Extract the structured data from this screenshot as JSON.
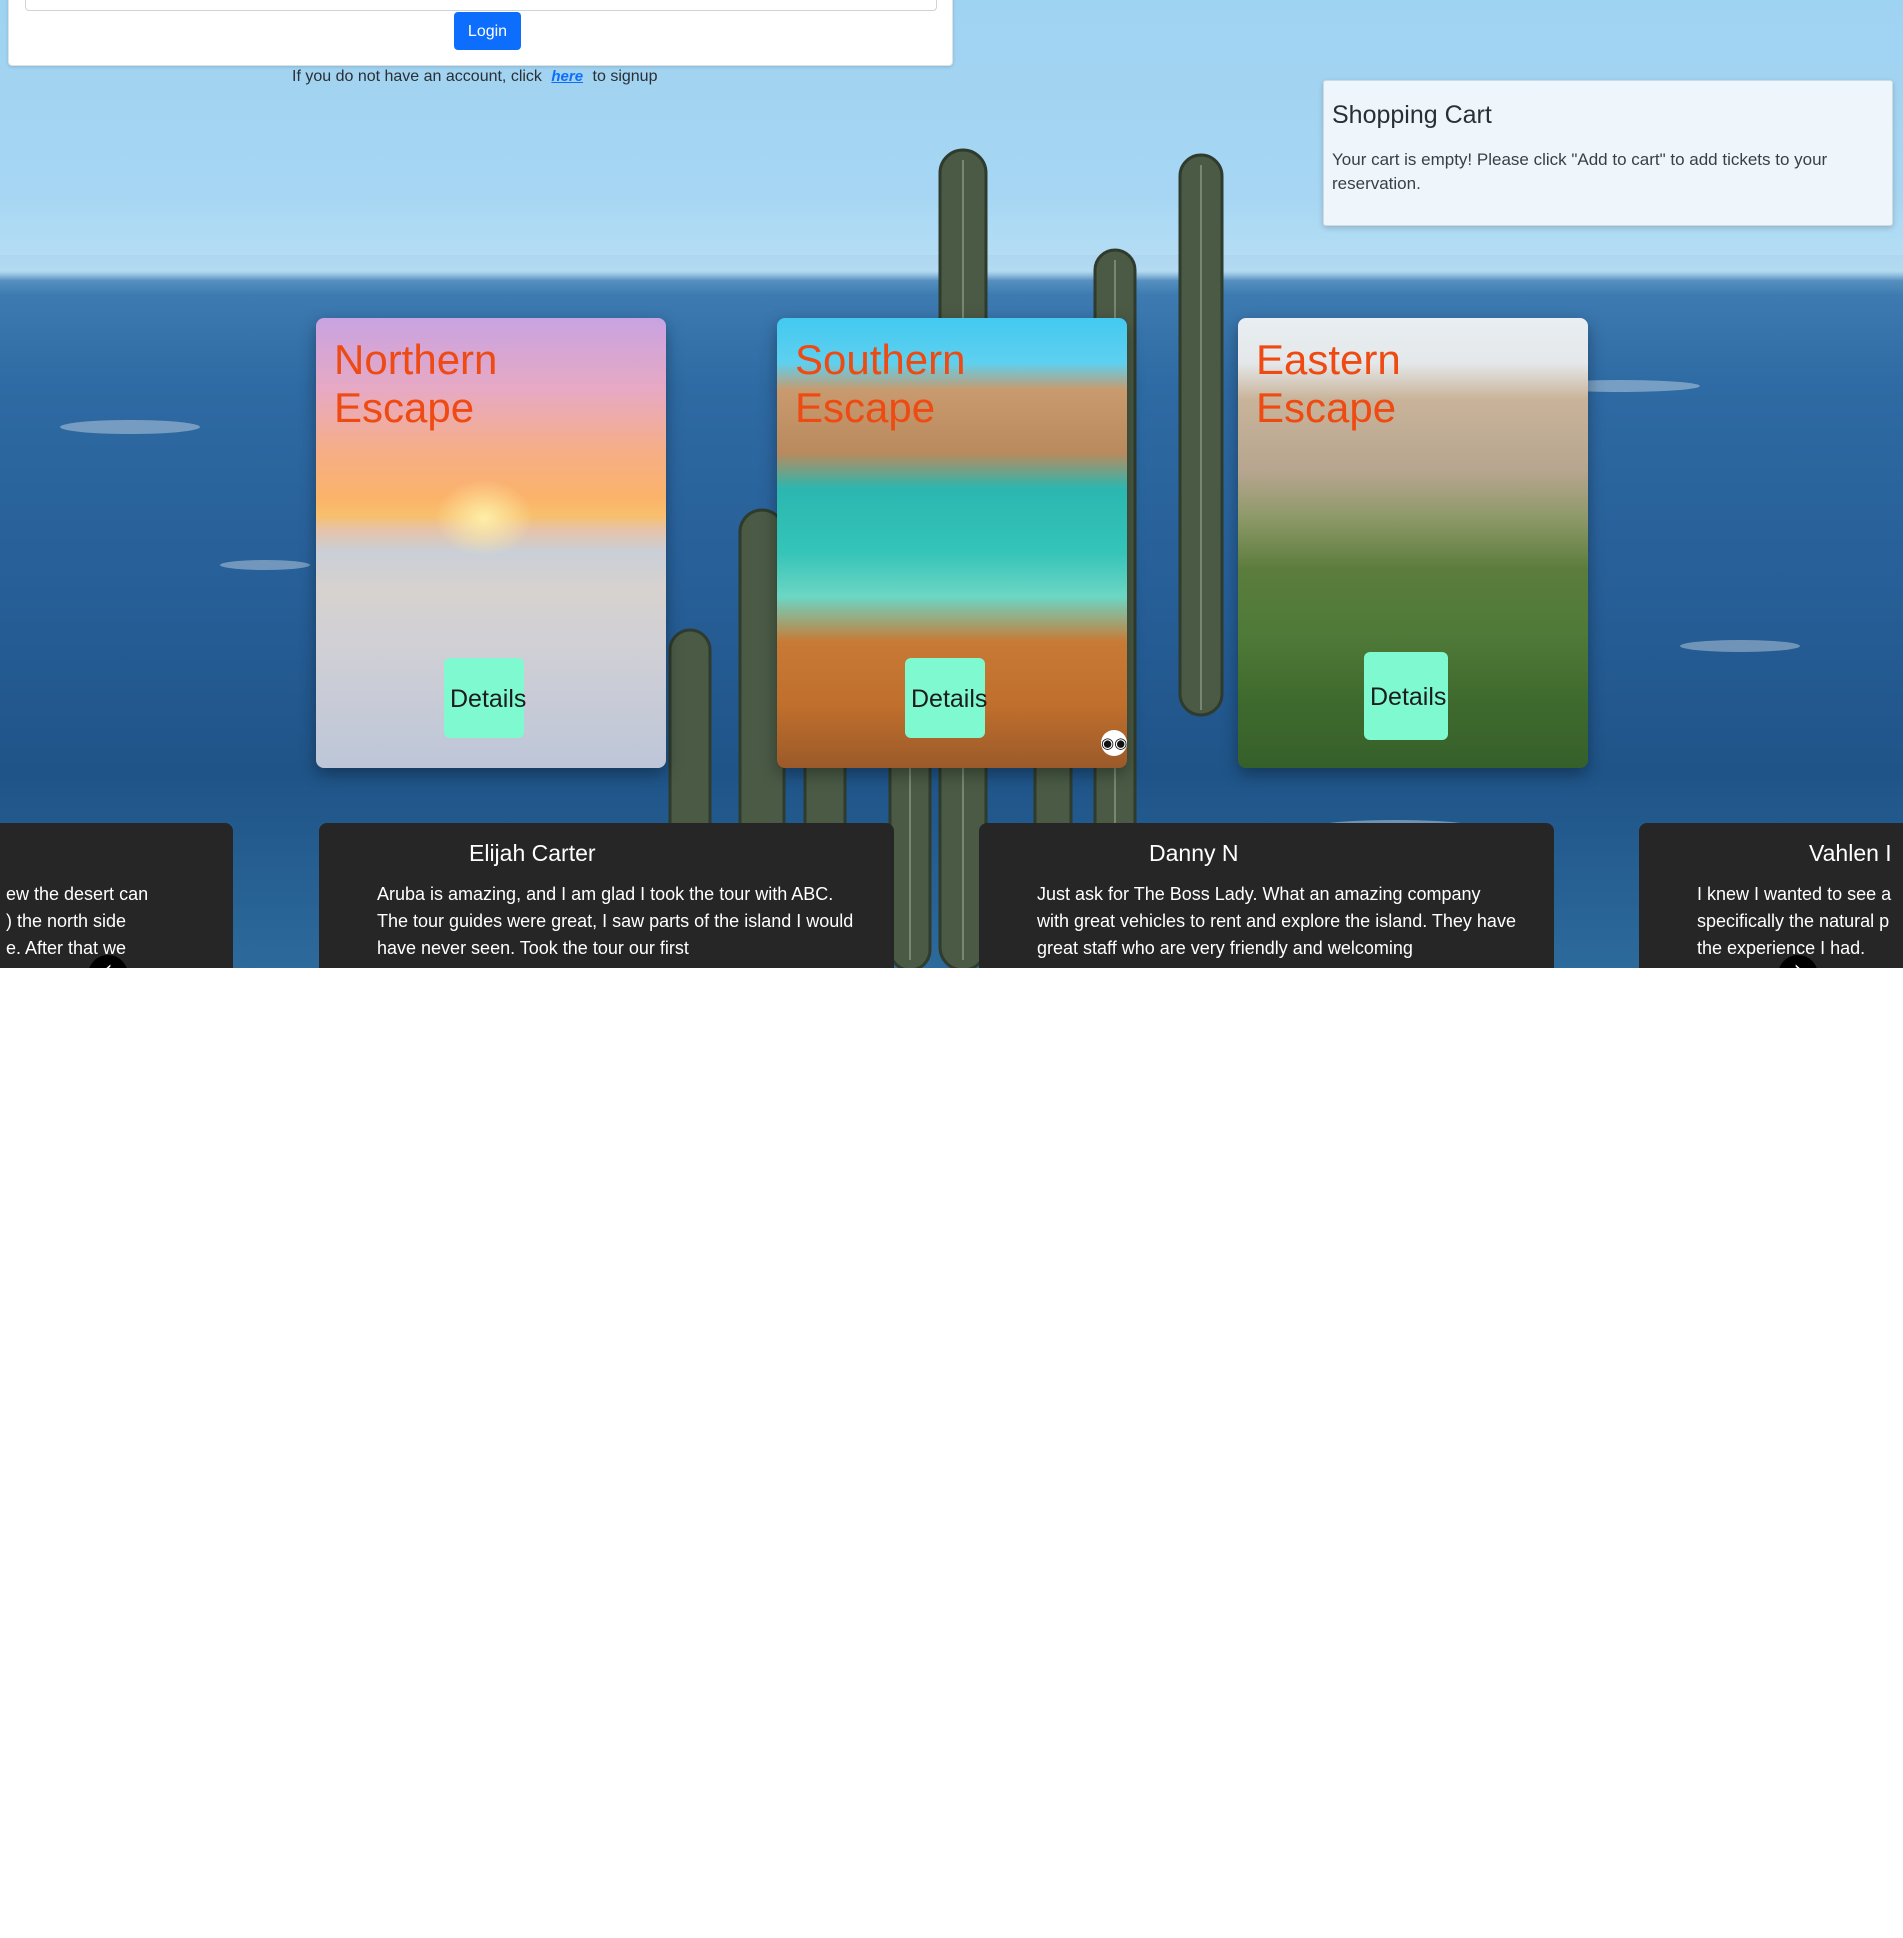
{
  "login": {
    "button_label": "Login",
    "signup_prefix": "If you do not have an account, click",
    "signup_link": "here",
    "signup_suffix": "to signup"
  },
  "cart": {
    "title": "Shopping Cart",
    "empty_message": "Your cart is empty! Please click \"Add to cart\" to add tickets to your reservation."
  },
  "tours": [
    {
      "title": "Northern\nEscape",
      "button_label": "Details"
    },
    {
      "title": "Southern\nEscape",
      "button_label": "Details"
    },
    {
      "title": "Eastern\nEscape",
      "button_label": "Details"
    }
  ],
  "reviews": [
    {
      "name": "",
      "text": "ew the desert can\n) the north side\ne. After that we"
    },
    {
      "name": "Elijah Carter",
      "text": "Aruba is amazing, and I am glad I took the tour with ABC. The tour guides were great, I saw parts of the island I would have never seen. Took the tour our first"
    },
    {
      "name": "Danny N",
      "text": "Just ask for The Boss Lady. What an amazing company with great vehicles to rent and explore the island. They have great staff who are very friendly and welcoming"
    },
    {
      "name": "Vahlen I",
      "text": "I knew I wanted to see a\nspecifically the natural p\nthe experience I had."
    }
  ],
  "carousel": {
    "prev_icon": "‹",
    "next_icon": "›"
  },
  "colors": {
    "primary_button": "#0d6efd",
    "tour_title": "#ee4a12",
    "details_button": "#7ffad0",
    "review_card": "#262626"
  }
}
